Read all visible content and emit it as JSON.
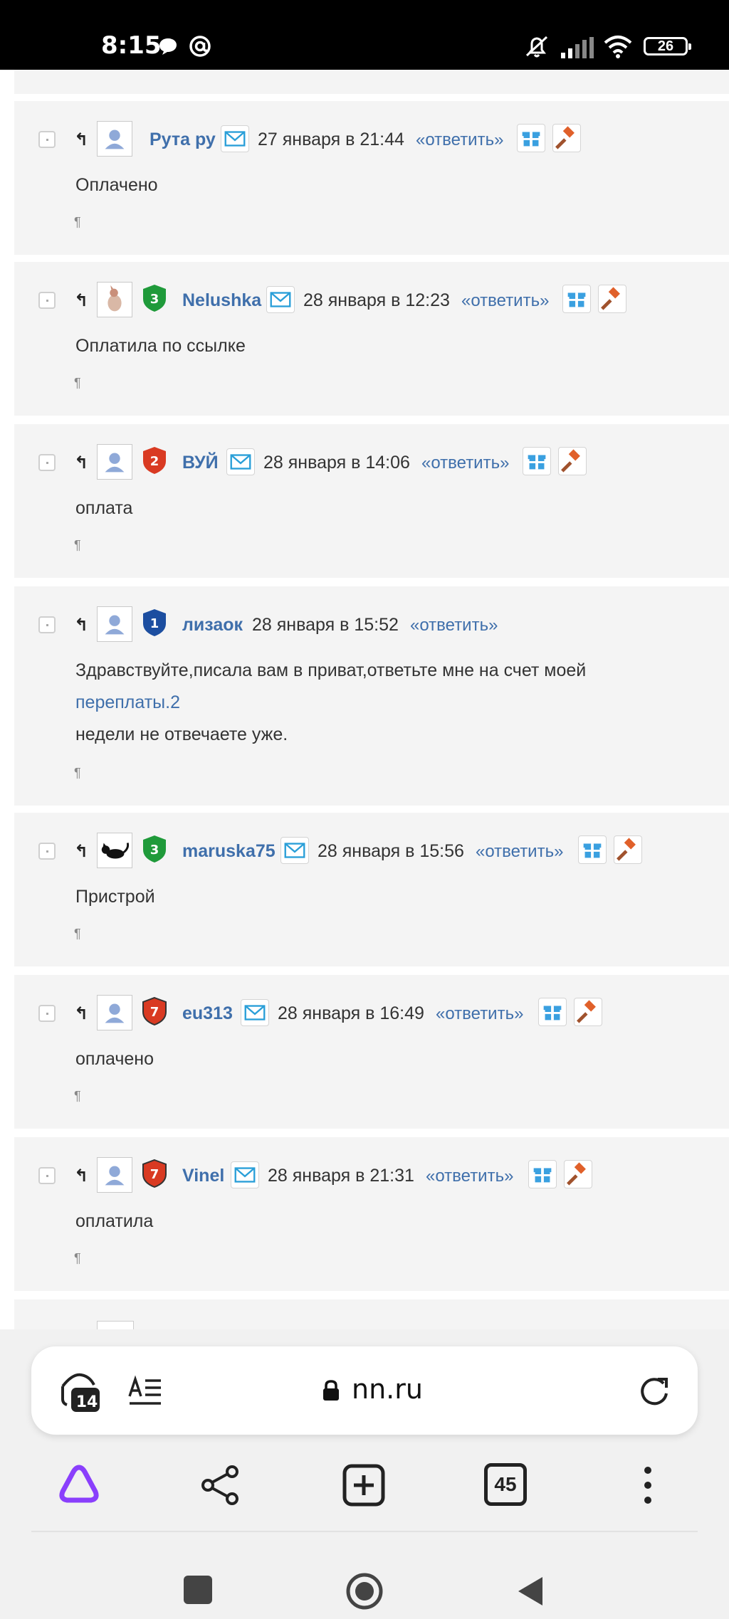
{
  "status_bar": {
    "time": "8:15",
    "battery": "26",
    "icons": [
      "message-icon",
      "at-icon",
      "mute-icon",
      "signal-icon",
      "wifi-icon",
      "battery-icon"
    ]
  },
  "comments": [
    {
      "username": "Рута ру",
      "date": "27 января в 21:44",
      "reply": "«ответить»",
      "text": "Оплачено",
      "avatar": "default-avatar",
      "badge": "",
      "mail": true,
      "actions": true
    },
    {
      "username": "Nelushka",
      "date": "28 января в 12:23",
      "reply": "«ответить»",
      "text": "Оплатила по ссылке",
      "avatar": "cat-avatar",
      "badge": "3",
      "mail": true,
      "actions": true
    },
    {
      "username": "ВУЙ",
      "date": "28 января в 14:06",
      "reply": "«ответить»",
      "text": "оплата",
      "avatar": "default-avatar",
      "badge": "2",
      "mail": true,
      "actions": true
    },
    {
      "username": "лизаок",
      "date": "28 января в 15:52",
      "reply": "«ответить»",
      "text_line1": "Здравствуйте,писала вам в приват,ответьте мне на счет моей",
      "text_link": "переплаты.2",
      "text_line3": "недели не отвечаете уже.",
      "avatar": "default-avatar",
      "badge": "1",
      "mail": false,
      "actions": false
    },
    {
      "username": "maruska75",
      "date": "28 января в 15:56",
      "reply": "«ответить»",
      "text": "Пристрой",
      "avatar": "black-cat-avatar",
      "badge": "3",
      "mail": true,
      "actions": true
    },
    {
      "username": "eu313",
      "date": "28 января в 16:49",
      "reply": "«ответить»",
      "text": "оплачено",
      "avatar": "default-avatar",
      "badge": "7",
      "mail": true,
      "actions": true
    },
    {
      "username": "Vinel",
      "date": "28 января в 21:31",
      "reply": "«ответить»",
      "text": "оплатила",
      "avatar": "default-avatar",
      "badge": "7",
      "mail": true,
      "actions": true
    }
  ],
  "browser": {
    "url": "nn.ru",
    "shield_count": "14",
    "tab_count": "45"
  },
  "colors": {
    "link": "#3f6fab",
    "comment_bg": "#f4f4f4",
    "badge_green": "#1f9a3a",
    "badge_red": "#d93a22",
    "badge_blue": "#1c4ea0",
    "alice_purple": "#8a3ffc"
  }
}
